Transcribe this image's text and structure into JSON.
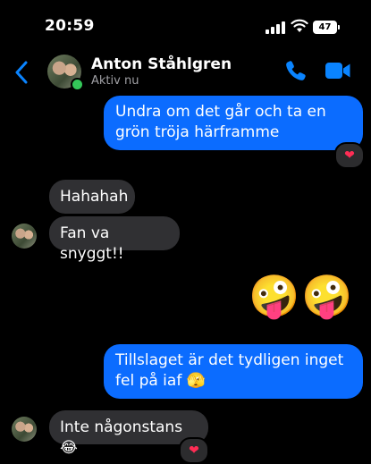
{
  "status_bar": {
    "time": "20:59",
    "battery": "47"
  },
  "header": {
    "contact_name": "Anton Ståhlgren",
    "status": "Aktiv nu"
  },
  "messages": [
    {
      "direction": "outgoing",
      "text": "Undra om det går och ta en grön tröja härframme",
      "reaction": "❤"
    },
    {
      "direction": "incoming",
      "text": "Hahahah"
    },
    {
      "direction": "incoming",
      "text": "Fan va snyggt!!"
    },
    {
      "direction": "outgoing",
      "emoji": [
        "🤪",
        "🤪"
      ]
    },
    {
      "direction": "outgoing",
      "text": "Tillslaget är det tydligen inget fel på iaf 🫣"
    },
    {
      "direction": "incoming",
      "text": "Inte någonstans😂",
      "reaction": "❤"
    }
  ],
  "colors": {
    "outgoing_bubble": "#0b6cff",
    "incoming_bubble": "#303033",
    "accent": "#0a84ff",
    "online": "#34c759"
  },
  "icons": [
    "back-chevron-icon",
    "phone-icon",
    "video-camera-icon",
    "signal-icon",
    "wifi-icon",
    "battery-icon",
    "heart-icon"
  ]
}
